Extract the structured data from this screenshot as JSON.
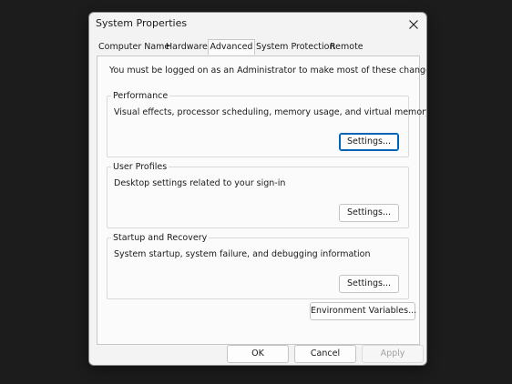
{
  "window": {
    "title": "System Properties"
  },
  "tabs": [
    {
      "label": "Computer Name"
    },
    {
      "label": "Hardware"
    },
    {
      "label": "Advanced",
      "active": true
    },
    {
      "label": "System Protection"
    },
    {
      "label": "Remote"
    }
  ],
  "advanced": {
    "admin_note": "You must be logged on as an Administrator to make most of these changes.",
    "performance": {
      "label": "Performance",
      "description": "Visual effects, processor scheduling, memory usage, and virtual memory",
      "button": "Settings..."
    },
    "user_profiles": {
      "label": "User Profiles",
      "description": "Desktop settings related to your sign-in",
      "button": "Settings..."
    },
    "startup_recovery": {
      "label": "Startup and Recovery",
      "description": "System startup, system failure, and debugging information",
      "button": "Settings..."
    },
    "environment_button": "Environment Variables..."
  },
  "footer": {
    "ok_label": "OK",
    "cancel_label": "Cancel",
    "apply_label": "Apply"
  },
  "colors": {
    "backdrop": "#1c1c1c",
    "dialog": "#f3f3f3",
    "panel": "#fbfbfb",
    "focus_accent": "#0067c0",
    "disabled_text": "#a2a2a2"
  },
  "icons": {
    "close": "close-icon"
  }
}
